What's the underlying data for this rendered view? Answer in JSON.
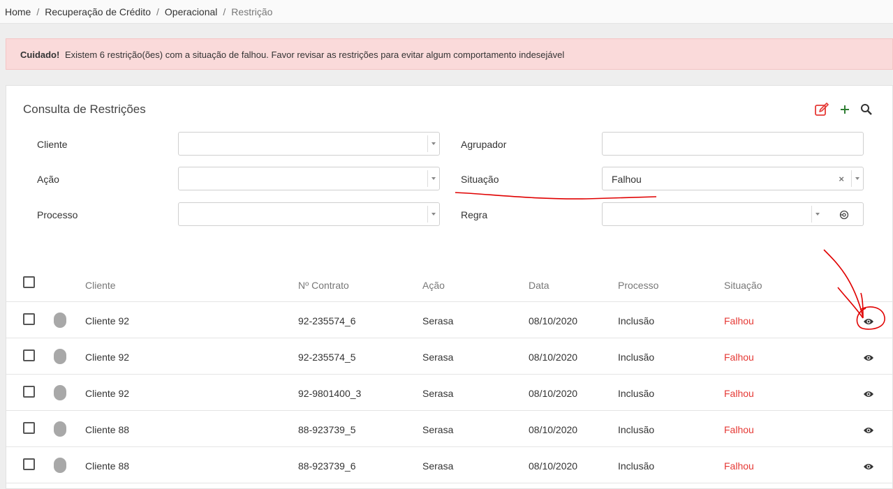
{
  "breadcrumb": {
    "items": [
      "Home",
      "Recuperação de Crédito",
      "Operacional"
    ],
    "current": "Restrição",
    "separator": "/"
  },
  "alert": {
    "title": "Cuidado!",
    "message": "Existem 6 restrição(ões) com a situação de falhou. Favor revisar as restrições para evitar algum comportamento indesejável"
  },
  "panel": {
    "title": "Consulta de Restrições",
    "actions": {
      "edit_icon": "edit-icon",
      "add_icon": "plus-icon",
      "search_icon": "search-icon"
    }
  },
  "filters": {
    "cliente": {
      "label": "Cliente",
      "value": ""
    },
    "agrupador": {
      "label": "Agrupador",
      "value": ""
    },
    "acao": {
      "label": "Ação",
      "value": ""
    },
    "situacao": {
      "label": "Situação",
      "value": "Falhou",
      "clear": "×"
    },
    "processo": {
      "label": "Processo",
      "value": ""
    },
    "regra": {
      "label": "Regra",
      "value": ""
    }
  },
  "table": {
    "headers": {
      "cliente": "Cliente",
      "contrato": "Nº Contrato",
      "acao": "Ação",
      "data": "Data",
      "processo": "Processo",
      "situacao": "Situação"
    },
    "rows": [
      {
        "cliente": "Cliente 92",
        "contrato": "92-235574_6",
        "acao": "Serasa",
        "data": "08/10/2020",
        "processo": "Inclusão",
        "situacao": "Falhou"
      },
      {
        "cliente": "Cliente 92",
        "contrato": "92-235574_5",
        "acao": "Serasa",
        "data": "08/10/2020",
        "processo": "Inclusão",
        "situacao": "Falhou"
      },
      {
        "cliente": "Cliente 92",
        "contrato": "92-9801400_3",
        "acao": "Serasa",
        "data": "08/10/2020",
        "processo": "Inclusão",
        "situacao": "Falhou"
      },
      {
        "cliente": "Cliente 88",
        "contrato": "88-923739_5",
        "acao": "Serasa",
        "data": "08/10/2020",
        "processo": "Inclusão",
        "situacao": "Falhou"
      },
      {
        "cliente": "Cliente 88",
        "contrato": "88-923739_6",
        "acao": "Serasa",
        "data": "08/10/2020",
        "processo": "Inclusão",
        "situacao": "Falhou"
      }
    ]
  },
  "colors": {
    "alert_bg": "#fadada",
    "status_failed": "#e53935",
    "accent_red": "#e53935",
    "accent_green": "#2e7d32",
    "annotation": "#e00000"
  }
}
